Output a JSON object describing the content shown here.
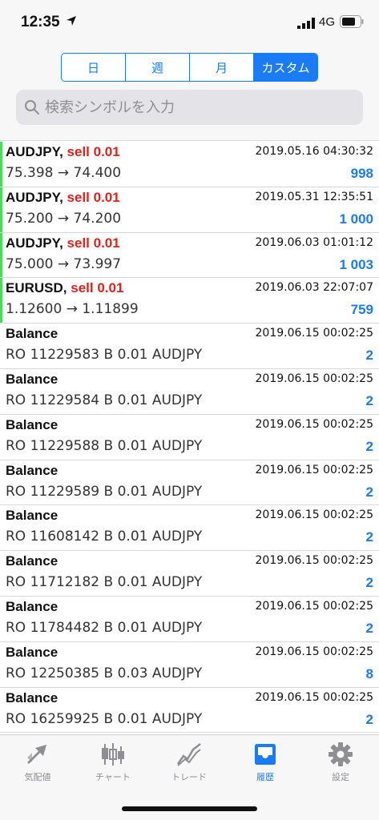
{
  "status_bar": {
    "time": "12:35",
    "network": "4G"
  },
  "period_tabs": [
    {
      "label": "日",
      "active": false
    },
    {
      "label": "週",
      "active": false
    },
    {
      "label": "月",
      "active": false
    },
    {
      "label": "カスタム",
      "active": true
    }
  ],
  "search": {
    "placeholder": "検索シンボルを入力"
  },
  "history": [
    {
      "symbol": "AUDJPY,",
      "deal": "sell 0.01",
      "time": "2019.05.16 04:30:32",
      "detail": "75.398 → 74.400",
      "profit": "998",
      "accent": true
    },
    {
      "symbol": "AUDJPY,",
      "deal": "sell 0.01",
      "time": "2019.05.31 12:35:51",
      "detail": "75.200 → 74.200",
      "profit": "1 000",
      "accent": true
    },
    {
      "symbol": "AUDJPY,",
      "deal": "sell 0.01",
      "time": "2019.06.03 01:01:12",
      "detail": "75.000 → 73.997",
      "profit": "1 003",
      "accent": true
    },
    {
      "symbol": "EURUSD,",
      "deal": "sell 0.01",
      "time": "2019.06.03 22:07:07",
      "detail": "1.12600 → 1.11899",
      "profit": "759",
      "accent": true
    },
    {
      "symbol": "Balance",
      "deal": "",
      "time": "2019.06.15 00:02:25",
      "detail": "RO 11229583 B 0.01 AUDJPY",
      "profit": "2",
      "accent": false
    },
    {
      "symbol": "Balance",
      "deal": "",
      "time": "2019.06.15 00:02:25",
      "detail": "RO 11229584 B 0.01 AUDJPY",
      "profit": "2",
      "accent": false
    },
    {
      "symbol": "Balance",
      "deal": "",
      "time": "2019.06.15 00:02:25",
      "detail": "RO 11229588 B 0.01 AUDJPY",
      "profit": "2",
      "accent": false
    },
    {
      "symbol": "Balance",
      "deal": "",
      "time": "2019.06.15 00:02:25",
      "detail": "RO 11229589 B 0.01 AUDJPY",
      "profit": "2",
      "accent": false
    },
    {
      "symbol": "Balance",
      "deal": "",
      "time": "2019.06.15 00:02:25",
      "detail": "RO 11608142 B 0.01 AUDJPY",
      "profit": "2",
      "accent": false
    },
    {
      "symbol": "Balance",
      "deal": "",
      "time": "2019.06.15 00:02:25",
      "detail": "RO 11712182 B 0.01 AUDJPY",
      "profit": "2",
      "accent": false
    },
    {
      "symbol": "Balance",
      "deal": "",
      "time": "2019.06.15 00:02:25",
      "detail": "RO 11784482 B 0.01 AUDJPY",
      "profit": "2",
      "accent": false
    },
    {
      "symbol": "Balance",
      "deal": "",
      "time": "2019.06.15 00:02:25",
      "detail": "RO 12250385 B 0.03 AUDJPY",
      "profit": "8",
      "accent": false
    },
    {
      "symbol": "Balance",
      "deal": "",
      "time": "2019.06.15 00:02:25",
      "detail": "RO 16259925 B 0.01 AUDJPY",
      "profit": "2",
      "accent": false
    }
  ],
  "tabbar": [
    {
      "label": "気配値",
      "icon": "quotes-arrows-icon",
      "active": false
    },
    {
      "label": "チャート",
      "icon": "candlestick-chart-icon",
      "active": false
    },
    {
      "label": "トレード",
      "icon": "trade-line-icon",
      "active": false
    },
    {
      "label": "履歴",
      "icon": "history-inbox-icon",
      "active": true
    },
    {
      "label": "設定",
      "icon": "gear-icon",
      "active": false
    }
  ],
  "colors": {
    "accent": "#1a7cf5",
    "sell": "#e0221d",
    "position_bar": "#4cd964",
    "inactive_icon": "#8e8e93"
  }
}
